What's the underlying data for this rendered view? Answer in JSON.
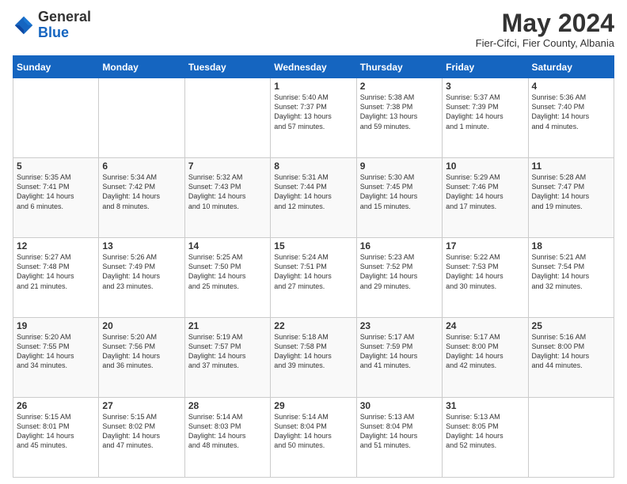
{
  "header": {
    "logo_general": "General",
    "logo_blue": "Blue",
    "month_title": "May 2024",
    "subtitle": "Fier-Cifci, Fier County, Albania"
  },
  "days_of_week": [
    "Sunday",
    "Monday",
    "Tuesday",
    "Wednesday",
    "Thursday",
    "Friday",
    "Saturday"
  ],
  "weeks": [
    [
      {
        "num": "",
        "info": ""
      },
      {
        "num": "",
        "info": ""
      },
      {
        "num": "",
        "info": ""
      },
      {
        "num": "1",
        "info": "Sunrise: 5:40 AM\nSunset: 7:37 PM\nDaylight: 13 hours\nand 57 minutes."
      },
      {
        "num": "2",
        "info": "Sunrise: 5:38 AM\nSunset: 7:38 PM\nDaylight: 13 hours\nand 59 minutes."
      },
      {
        "num": "3",
        "info": "Sunrise: 5:37 AM\nSunset: 7:39 PM\nDaylight: 14 hours\nand 1 minute."
      },
      {
        "num": "4",
        "info": "Sunrise: 5:36 AM\nSunset: 7:40 PM\nDaylight: 14 hours\nand 4 minutes."
      }
    ],
    [
      {
        "num": "5",
        "info": "Sunrise: 5:35 AM\nSunset: 7:41 PM\nDaylight: 14 hours\nand 6 minutes."
      },
      {
        "num": "6",
        "info": "Sunrise: 5:34 AM\nSunset: 7:42 PM\nDaylight: 14 hours\nand 8 minutes."
      },
      {
        "num": "7",
        "info": "Sunrise: 5:32 AM\nSunset: 7:43 PM\nDaylight: 14 hours\nand 10 minutes."
      },
      {
        "num": "8",
        "info": "Sunrise: 5:31 AM\nSunset: 7:44 PM\nDaylight: 14 hours\nand 12 minutes."
      },
      {
        "num": "9",
        "info": "Sunrise: 5:30 AM\nSunset: 7:45 PM\nDaylight: 14 hours\nand 15 minutes."
      },
      {
        "num": "10",
        "info": "Sunrise: 5:29 AM\nSunset: 7:46 PM\nDaylight: 14 hours\nand 17 minutes."
      },
      {
        "num": "11",
        "info": "Sunrise: 5:28 AM\nSunset: 7:47 PM\nDaylight: 14 hours\nand 19 minutes."
      }
    ],
    [
      {
        "num": "12",
        "info": "Sunrise: 5:27 AM\nSunset: 7:48 PM\nDaylight: 14 hours\nand 21 minutes."
      },
      {
        "num": "13",
        "info": "Sunrise: 5:26 AM\nSunset: 7:49 PM\nDaylight: 14 hours\nand 23 minutes."
      },
      {
        "num": "14",
        "info": "Sunrise: 5:25 AM\nSunset: 7:50 PM\nDaylight: 14 hours\nand 25 minutes."
      },
      {
        "num": "15",
        "info": "Sunrise: 5:24 AM\nSunset: 7:51 PM\nDaylight: 14 hours\nand 27 minutes."
      },
      {
        "num": "16",
        "info": "Sunrise: 5:23 AM\nSunset: 7:52 PM\nDaylight: 14 hours\nand 29 minutes."
      },
      {
        "num": "17",
        "info": "Sunrise: 5:22 AM\nSunset: 7:53 PM\nDaylight: 14 hours\nand 30 minutes."
      },
      {
        "num": "18",
        "info": "Sunrise: 5:21 AM\nSunset: 7:54 PM\nDaylight: 14 hours\nand 32 minutes."
      }
    ],
    [
      {
        "num": "19",
        "info": "Sunrise: 5:20 AM\nSunset: 7:55 PM\nDaylight: 14 hours\nand 34 minutes."
      },
      {
        "num": "20",
        "info": "Sunrise: 5:20 AM\nSunset: 7:56 PM\nDaylight: 14 hours\nand 36 minutes."
      },
      {
        "num": "21",
        "info": "Sunrise: 5:19 AM\nSunset: 7:57 PM\nDaylight: 14 hours\nand 37 minutes."
      },
      {
        "num": "22",
        "info": "Sunrise: 5:18 AM\nSunset: 7:58 PM\nDaylight: 14 hours\nand 39 minutes."
      },
      {
        "num": "23",
        "info": "Sunrise: 5:17 AM\nSunset: 7:59 PM\nDaylight: 14 hours\nand 41 minutes."
      },
      {
        "num": "24",
        "info": "Sunrise: 5:17 AM\nSunset: 8:00 PM\nDaylight: 14 hours\nand 42 minutes."
      },
      {
        "num": "25",
        "info": "Sunrise: 5:16 AM\nSunset: 8:00 PM\nDaylight: 14 hours\nand 44 minutes."
      }
    ],
    [
      {
        "num": "26",
        "info": "Sunrise: 5:15 AM\nSunset: 8:01 PM\nDaylight: 14 hours\nand 45 minutes."
      },
      {
        "num": "27",
        "info": "Sunrise: 5:15 AM\nSunset: 8:02 PM\nDaylight: 14 hours\nand 47 minutes."
      },
      {
        "num": "28",
        "info": "Sunrise: 5:14 AM\nSunset: 8:03 PM\nDaylight: 14 hours\nand 48 minutes."
      },
      {
        "num": "29",
        "info": "Sunrise: 5:14 AM\nSunset: 8:04 PM\nDaylight: 14 hours\nand 50 minutes."
      },
      {
        "num": "30",
        "info": "Sunrise: 5:13 AM\nSunset: 8:04 PM\nDaylight: 14 hours\nand 51 minutes."
      },
      {
        "num": "31",
        "info": "Sunrise: 5:13 AM\nSunset: 8:05 PM\nDaylight: 14 hours\nand 52 minutes."
      },
      {
        "num": "",
        "info": ""
      }
    ]
  ]
}
